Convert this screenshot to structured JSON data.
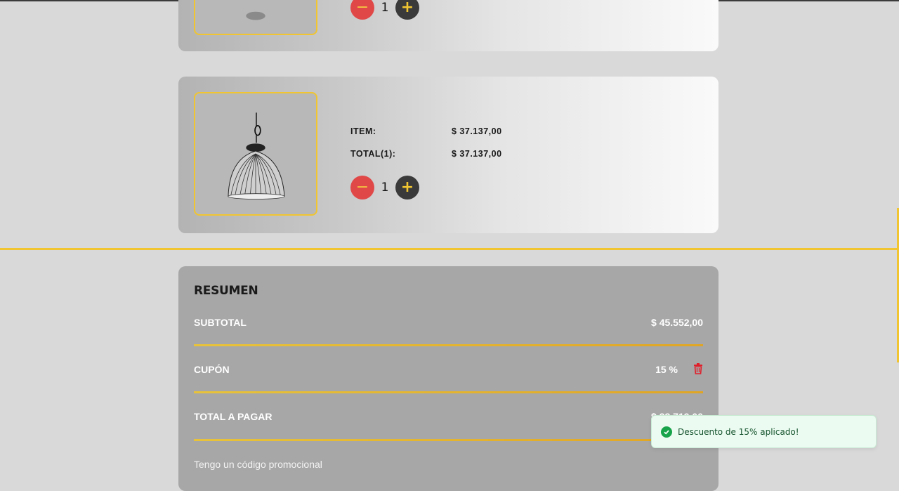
{
  "cart": {
    "items": [
      {
        "quantity": "1"
      },
      {
        "item_label": "ITEM:",
        "item_value": "$ 37.137,00",
        "total_label": "TOTAL(1):",
        "total_value": "$ 37.137,00",
        "quantity": "1"
      }
    ],
    "minus_symbol": "−",
    "plus_symbol": "+"
  },
  "summary": {
    "title": "RESUMEN",
    "subtotal_label": "SUBTOTAL",
    "subtotal_value": "$ 45.552,00",
    "coupon_label": "CUPÓN",
    "coupon_value": "15 %",
    "total_label": "TOTAL A PAGAR",
    "total_value": "$ 38.719,00",
    "promo_text": "Tengo un código promocional"
  },
  "toast": {
    "message": "Descuento de 15% aplicado!",
    "icon": "check-circle-icon"
  },
  "colors": {
    "accent": "#f0c531",
    "minus_button": "#e04848",
    "plus_button": "#3a3a3a",
    "delete": "#e01f2a",
    "toast_bg": "#ecfbf1"
  }
}
